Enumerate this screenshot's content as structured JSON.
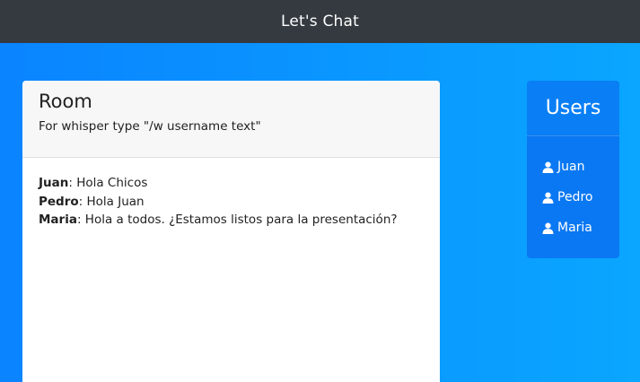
{
  "navbar": {
    "brand": "Let's Chat"
  },
  "room": {
    "title": "Room",
    "hint": "For whisper type \"/w username text\"",
    "messages": [
      {
        "author": "Juan",
        "text": ": Hola Chicos"
      },
      {
        "author": "Pedro",
        "text": ": Hola Juan"
      },
      {
        "author": "Maria",
        "text": ": Hola a todos. ¿Estamos listos para la presentación?"
      }
    ]
  },
  "users": {
    "title": "Users",
    "items": [
      {
        "name": "Juan",
        "icon": "user-icon"
      },
      {
        "name": "Pedro",
        "icon": "user-icon"
      },
      {
        "name": "Maria",
        "icon": "user-icon"
      }
    ]
  },
  "colors": {
    "navbar": "#343a40",
    "background_start": "#0a84ff",
    "background_end": "#0aa6ff",
    "users_panel": "#0a78f2"
  }
}
